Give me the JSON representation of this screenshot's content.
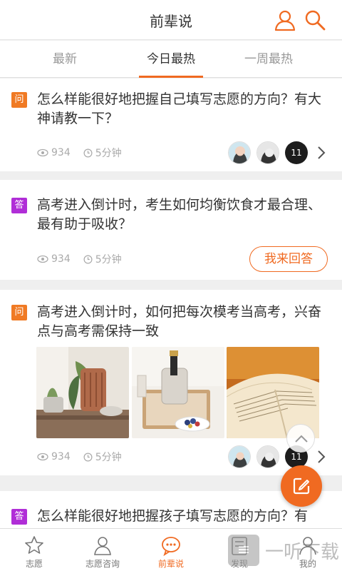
{
  "header": {
    "title": "前辈说",
    "user_icon": "user-icon",
    "search_icon": "search-icon",
    "accent": "#f06a21"
  },
  "tabs": [
    {
      "label": "最新",
      "active": false
    },
    {
      "label": "今日最热",
      "active": true
    },
    {
      "label": "一周最热",
      "active": false
    }
  ],
  "cards": [
    {
      "badge": "问",
      "badge_type": "ask",
      "title": "怎么样能很好地把握自己填写志愿的方向？有大神请教一下？",
      "views": "934",
      "time": "5分钟",
      "avatar_count": "11"
    },
    {
      "badge": "答",
      "badge_type": "answer",
      "title": "高考进入倒计时，考生如何均衡饮食才最合理、最有助于吸收？",
      "views": "934",
      "time": "5分钟",
      "action_label": "我来回答"
    },
    {
      "badge": "问",
      "badge_type": "ask",
      "title": "高考进入倒计时，如何把每次模考当高考，兴奋点与高考需保持一致",
      "views": "934",
      "time": "5分钟",
      "avatar_count": "11",
      "images": [
        "plant-image",
        "champagne-image",
        "book-image"
      ]
    },
    {
      "badge": "答",
      "badge_type": "answer",
      "title": "怎么样能很好地把握孩子填写志愿的方向？有"
    }
  ],
  "bottom_nav": [
    {
      "label": "志愿",
      "icon": "star-icon",
      "active": false
    },
    {
      "label": "志愿咨询",
      "icon": "person-icon",
      "active": false
    },
    {
      "label": "前辈说",
      "icon": "chat-bubble-icon",
      "active": true
    },
    {
      "label": "发现",
      "icon": "discover-icon",
      "active": false
    },
    {
      "label": "我的",
      "icon": "profile-icon",
      "active": false
    }
  ],
  "watermark": {
    "text": "一听下载"
  },
  "colors": {
    "ask_badge": "#f07a24",
    "answer_badge": "#b02ed7",
    "active": "#f06a21"
  }
}
